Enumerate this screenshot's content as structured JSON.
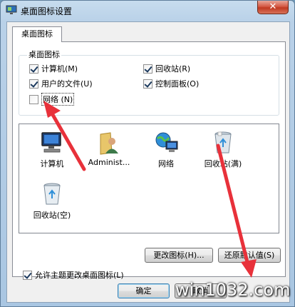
{
  "window": {
    "title": "桌面图标设置",
    "close_label": "✕"
  },
  "tabs": [
    {
      "label": "桌面图标"
    }
  ],
  "desktop_icons_group": {
    "label": "桌面图标",
    "items": [
      {
        "label": "计算机",
        "shortcut": "(M)",
        "checked": true
      },
      {
        "label": "回收站",
        "shortcut": "(R)",
        "checked": true
      },
      {
        "label": "用户的文件",
        "shortcut": "(U)",
        "checked": true
      },
      {
        "label": "控制面板",
        "shortcut": "(O)",
        "checked": true
      },
      {
        "label": "网络",
        "shortcut": "(N)",
        "checked": false
      }
    ]
  },
  "icon_list": [
    {
      "label": "计算机",
      "icon": "computer-icon"
    },
    {
      "label": "Administ...",
      "icon": "user-folder-icon"
    },
    {
      "label": "网络",
      "icon": "network-icon"
    },
    {
      "label": "回收站(满)",
      "icon": "recycle-bin-full-icon"
    },
    {
      "label": "回收站(空)",
      "icon": "recycle-bin-empty-icon"
    }
  ],
  "buttons": {
    "change_icon": "更改图标(H)...",
    "restore_default": "还原默认值(S)",
    "ok": "确定",
    "cancel": "取消"
  },
  "allow_themes": {
    "label": "允许主题更改桌面图标(L)",
    "checked": true
  },
  "watermark": "win1032.com",
  "colors": {
    "annotation_arrow": "#e8313a",
    "title_bar": "#b9d1e8"
  }
}
